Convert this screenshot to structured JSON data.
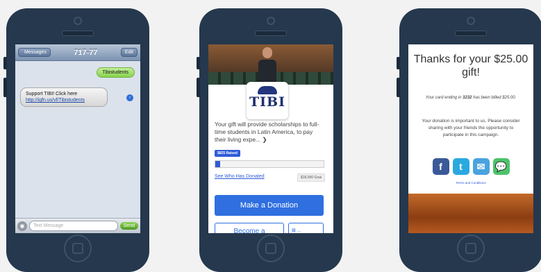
{
  "sms": {
    "back_label": "Messages",
    "title": "717-77",
    "edit_label": "Edit",
    "outgoing_message": "Tibistudents",
    "incoming_line1": "Support TIBI! Click here",
    "incoming_link": "http://igfn.us/vf/Tibistudents",
    "info_icon": "›",
    "input_placeholder": "Text Message",
    "send_label": "Send"
  },
  "campaign": {
    "logo_text": "TIBI",
    "description": "Your gift will provide scholarships to full-time students in Latin America, to pay their living expe... ❯",
    "raised_label": "$825 Raised",
    "progress_fraction": 0.045,
    "who_donated_link": "See Who Has Donated",
    "goal_label": "$18,000 Goal",
    "donate_button": "Make a Donation",
    "become_button": "Become a",
    "share_button": "⊠ ..."
  },
  "thanks": {
    "title": "Thanks for your $25.00 gift!",
    "billed_prefix": "Your card ending in ",
    "card_last4": "3232",
    "billed_suffix": " has been billed $25.00.",
    "share_text": "Your donation is important to us. Please consider sharing with your friends the opportunity to participate in this campaign.",
    "terms_link": "Terms and Conditions",
    "social": [
      {
        "icon": "facebook-icon",
        "glyph": "f",
        "color": "#3b5998"
      },
      {
        "icon": "twitter-icon",
        "glyph": "t",
        "color": "#2aa9e0"
      },
      {
        "icon": "email-icon",
        "glyph": "✉",
        "color": "#4aa3df"
      },
      {
        "icon": "sms-icon",
        "glyph": "💬",
        "color": "#4cc36b"
      }
    ]
  }
}
